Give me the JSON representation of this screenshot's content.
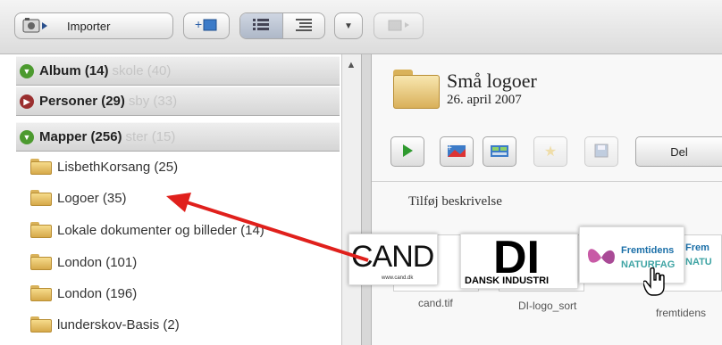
{
  "toolbar": {
    "import_label": "Importer",
    "icons": [
      "camera-icon",
      "add-album-icon",
      "list-view-icon",
      "detail-view-icon",
      "dropdown-icon",
      "share-icon"
    ]
  },
  "sidebar": {
    "sections": [
      {
        "label": "Album (14)",
        "ghost": "skole (40)",
        "state": "expanded",
        "icon": "expand-icon"
      },
      {
        "label": "Personer (29)",
        "ghost": "sby (33)",
        "state": "collapsed",
        "icon": "expand-icon"
      },
      {
        "label": "Mapper (256)",
        "ghost": "ster (15)",
        "state": "expanded",
        "icon": "expand-icon"
      }
    ],
    "folders": [
      {
        "label": "LisbethKorsang (25)"
      },
      {
        "label": "Logoer (35)"
      },
      {
        "label": "Lokale dokumenter og billeder (14)"
      },
      {
        "label": "London (101)"
      },
      {
        "label": "London (196)"
      },
      {
        "label": "lunderskov-Basis (2)"
      }
    ]
  },
  "album": {
    "title": "Små logoer",
    "date": "26. april 2007",
    "description_placeholder": "Tilføj beskrivelse"
  },
  "album_toolbar": {
    "share_label": "Del",
    "icons": [
      "play-icon",
      "slideshow-icon",
      "collage-icon",
      "star-icon",
      "save-icon"
    ]
  },
  "thumbnails": [
    {
      "caption": "cand.tif"
    },
    {
      "caption": "DI-logo_sort"
    },
    {
      "caption": "fremtidens"
    }
  ],
  "drag": {
    "cand_text": "CAND",
    "cand_sub": "www.cand.dk",
    "di_text": "DI",
    "di_sub": "DANSK INDUSTRI",
    "fremtid_text": "Fremtidens",
    "nat_text": "NATURFAG",
    "partial_nat": "NATU",
    "partial_frem": "Frem"
  },
  "colors": {
    "arrow": "#e0201c",
    "expand_green": "#4c9a2f",
    "collapse_red": "#9a2f2f"
  }
}
